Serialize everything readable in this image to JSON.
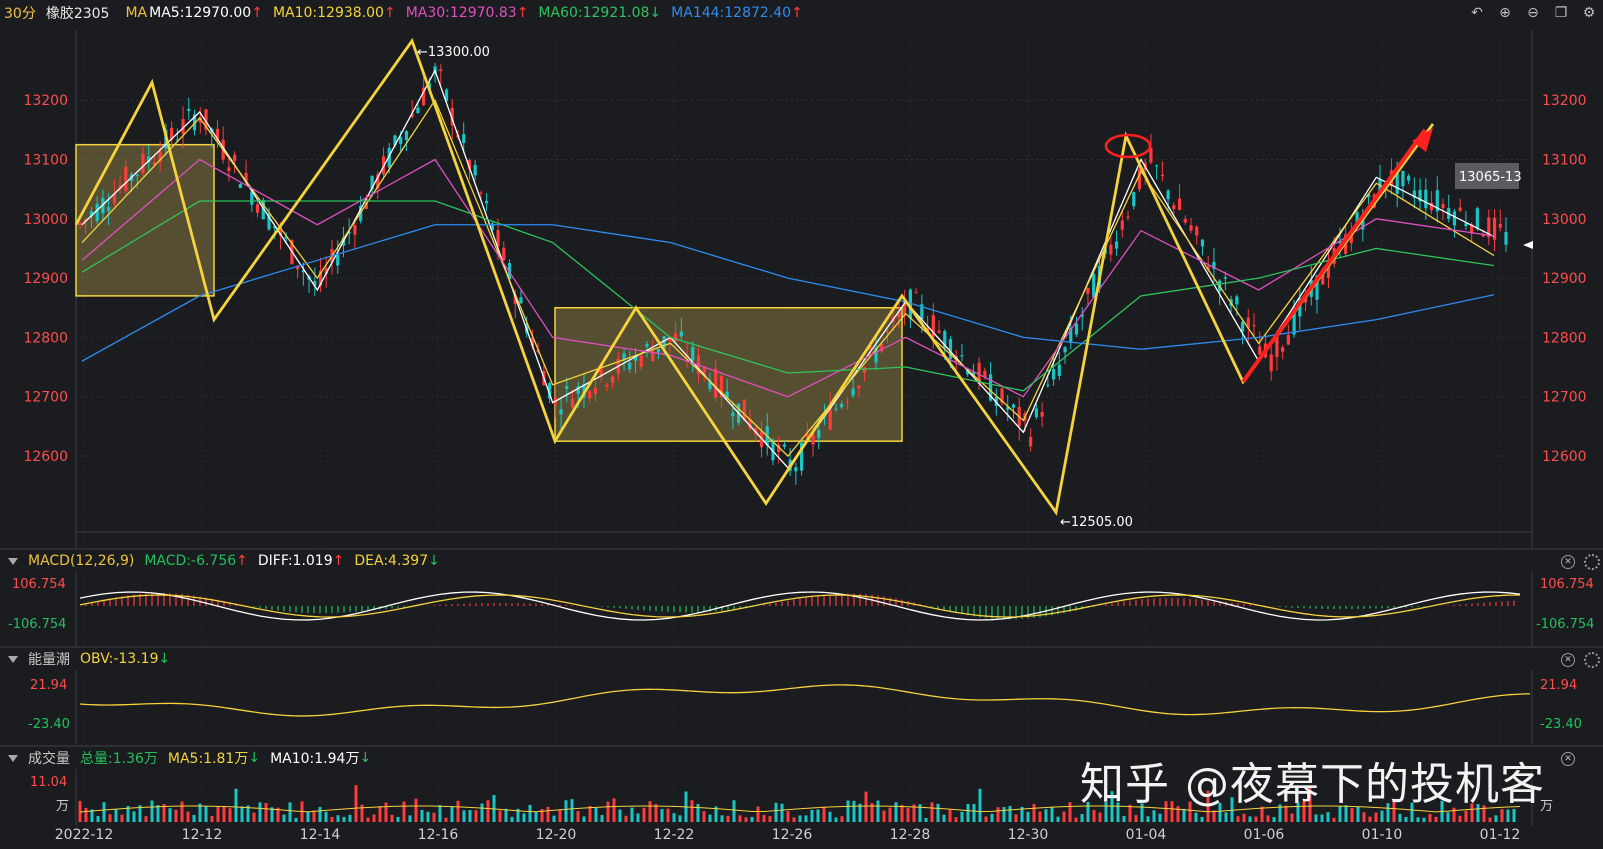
{
  "header": {
    "period": "30分",
    "symbol": "橡胶2305",
    "ma_label": "MA",
    "ma5": "MA5:12970.00",
    "ma10": "MA10:12938.00",
    "ma30": "MA30:12970.83",
    "ma60": "MA60:12921.08",
    "ma144": "MA144:12872.40",
    "colors": {
      "ma5": "#ffffff",
      "ma10": "#f5d33c",
      "ma30": "#e04fc0",
      "ma60": "#2ec45a",
      "ma144": "#2d8cf0"
    }
  },
  "macd_panel": {
    "title": "MACD(12,26,9)",
    "macd": "MACD:-6.756",
    "diff": "DIFF:1.019",
    "dea": "DEA:4.397",
    "top": "106.754",
    "bottom": "-106.754"
  },
  "obv_panel": {
    "title": "能量潮",
    "obv": "OBV:-13.19",
    "top": "21.94",
    "bottom": "-23.40"
  },
  "vol_panel": {
    "title": "成交量",
    "total": "总量:1.36万",
    "ma5": "MA5:1.81万",
    "ma10": "MA10:1.94万",
    "top": "11.04",
    "unit": "万"
  },
  "watermark": "知乎 @夜幕下的投机客",
  "chart_data": {
    "type": "line",
    "instrument": "橡胶2305",
    "period": "30分",
    "x_ticks": [
      "2022-12",
      "12-12",
      "12-14",
      "12-16",
      "12-20",
      "12-22",
      "12-26",
      "12-28",
      "12-30",
      "01-04",
      "01-06",
      "01-10",
      "01-12"
    ],
    "y_ticks": [
      12600,
      12700,
      12800,
      12900,
      13000,
      13100,
      13200
    ],
    "ylim": [
      12505,
      13300
    ],
    "annotations": {
      "high": "13300.00",
      "low": "12505.00",
      "price_tag": "13065-13"
    },
    "zigzag_pivots": [
      12990,
      13230,
      12830,
      13300,
      12625,
      12850,
      12520,
      12870,
      12505,
      13140,
      12725,
      13160
    ],
    "series": [
      {
        "name": "MA5",
        "values": [
          12990,
          13180,
          12880,
          13250,
          12690,
          12800,
          12580,
          12860,
          12640,
          13100,
          12760,
          13070,
          12970
        ]
      },
      {
        "name": "MA10",
        "values": [
          12960,
          13170,
          12900,
          13200,
          12720,
          12790,
          12600,
          12840,
          12660,
          13080,
          12790,
          13060,
          12938
        ]
      },
      {
        "name": "MA30",
        "values": [
          12930,
          13100,
          12990,
          13100,
          12800,
          12770,
          12700,
          12800,
          12700,
          12980,
          12880,
          13000,
          12971
        ]
      },
      {
        "name": "MA60",
        "values": [
          12910,
          13030,
          13030,
          13030,
          12960,
          12800,
          12740,
          12750,
          12710,
          12870,
          12900,
          12950,
          12921
        ]
      },
      {
        "name": "MA144",
        "values": [
          12760,
          12870,
          12930,
          12990,
          12990,
          12960,
          12900,
          12860,
          12800,
          12780,
          12800,
          12830,
          12872
        ]
      }
    ],
    "boxes": [
      {
        "price_range": [
          12870,
          13125
        ]
      },
      {
        "price_range": [
          12625,
          12850
        ]
      }
    ]
  }
}
